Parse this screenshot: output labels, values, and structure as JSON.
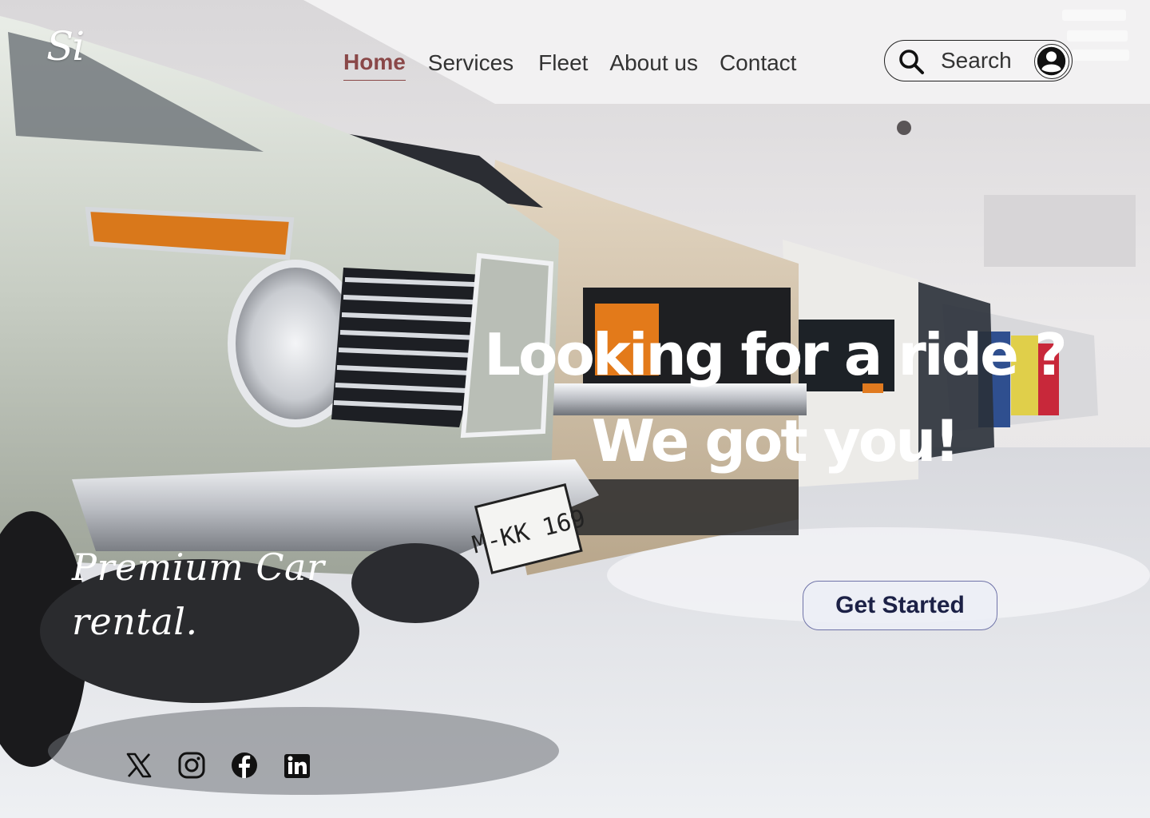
{
  "brand": {
    "logo_text": "Si"
  },
  "nav": {
    "items": [
      {
        "label": "Home",
        "active": true
      },
      {
        "label": "Services"
      },
      {
        "label": "Fleet"
      },
      {
        "label": "About us"
      },
      {
        "label": "Contact"
      }
    ]
  },
  "search": {
    "placeholder": "Search",
    "icon": "search-icon"
  },
  "account": {
    "icon": "user-icon"
  },
  "hero": {
    "headline_line1": "Looking for a ride ?",
    "headline_line2": "We got you!",
    "tagline_line1": "Premium Car",
    "tagline_line2": "rental.",
    "cta_label": "Get Started"
  },
  "social": {
    "items": [
      {
        "icon": "x-twitter-icon"
      },
      {
        "icon": "instagram-icon"
      },
      {
        "icon": "facebook-icon"
      },
      {
        "icon": "linkedin-icon"
      }
    ]
  },
  "background": {
    "plate_text": "M-KK 169"
  },
  "colors": {
    "nav_active": "#8a4848",
    "nav_text": "#333333",
    "cta_text": "#1c2146",
    "cta_border": "#6f73a8",
    "headline": "#ffffff"
  }
}
